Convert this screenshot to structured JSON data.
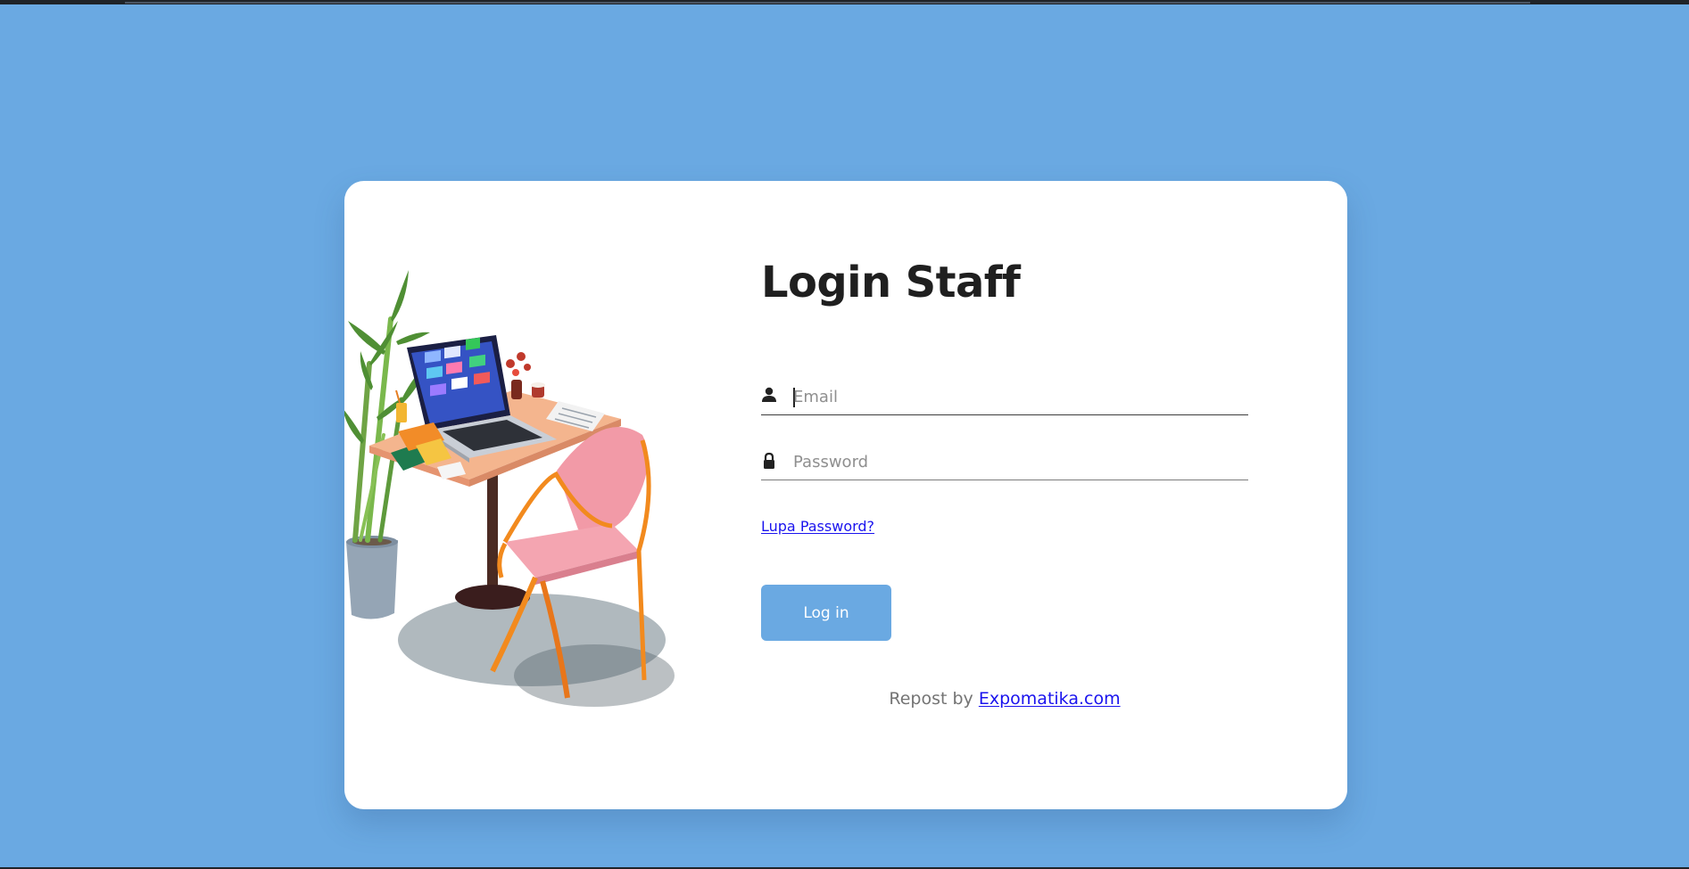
{
  "page": {
    "background_color": "#6aa9e2",
    "accent_color": "#6aa9e2",
    "link_color": "#1a13ee"
  },
  "illustration": {
    "description": "desk-with-laptop-chair-plant-illustration"
  },
  "login": {
    "title": "Login Staff",
    "email": {
      "icon": "user-icon",
      "value": "",
      "placeholder": "Email"
    },
    "password": {
      "icon": "lock-icon",
      "value": "",
      "placeholder": "Password"
    },
    "forgot_password_label": "Lupa Password?",
    "submit_label": "Log in"
  },
  "footer": {
    "repost_text": "Repost by",
    "repost_link": "Expomatika.com"
  }
}
